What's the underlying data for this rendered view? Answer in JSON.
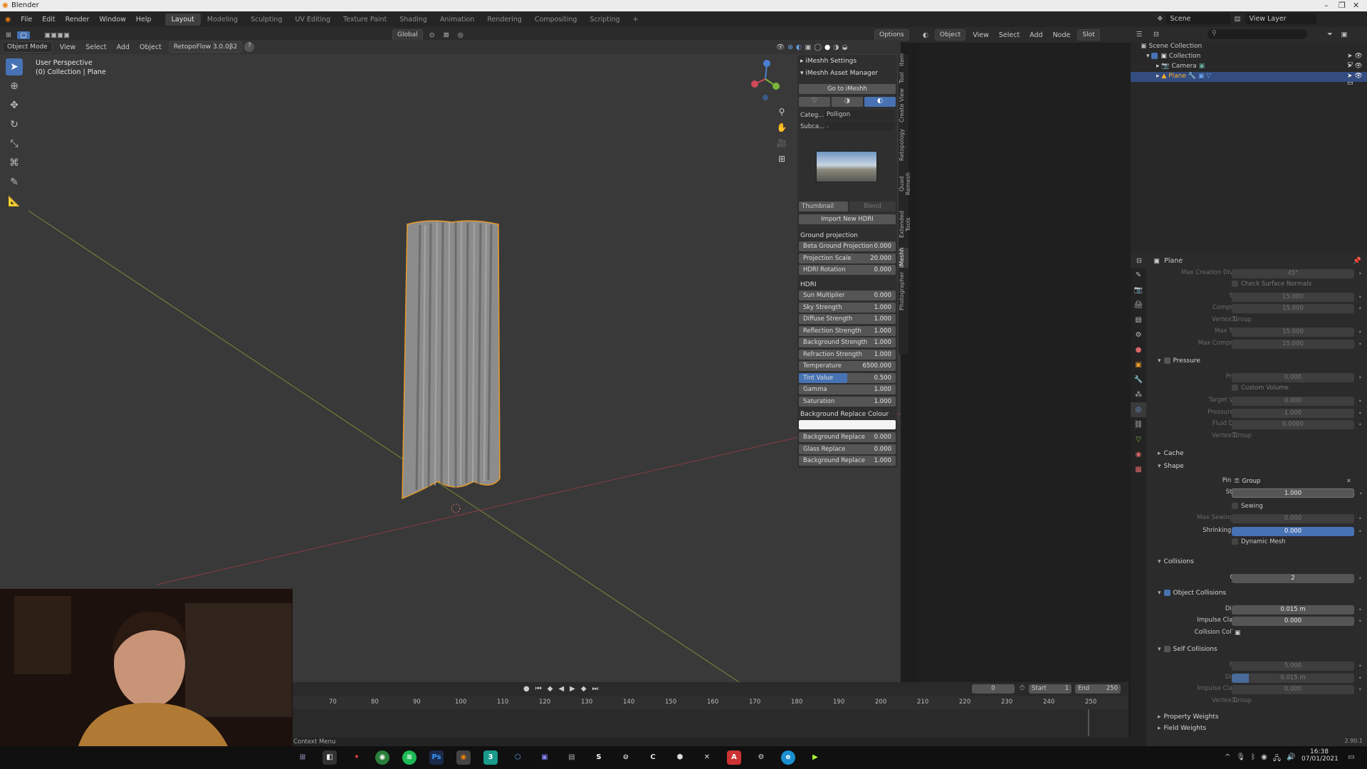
{
  "window": {
    "title": "Blender"
  },
  "menus": [
    "File",
    "Edit",
    "Render",
    "Window",
    "Help"
  ],
  "workspaces": [
    {
      "label": "Layout",
      "active": true
    },
    {
      "label": "Modeling"
    },
    {
      "label": "Sculpting"
    },
    {
      "label": "UV Editing"
    },
    {
      "label": "Texture Paint"
    },
    {
      "label": "Shading"
    },
    {
      "label": "Animation"
    },
    {
      "label": "Rendering"
    },
    {
      "label": "Compositing"
    },
    {
      "label": "Scripting"
    }
  ],
  "scene": {
    "label": "Scene",
    "view_layer": "View Layer"
  },
  "viewport_header": {
    "mode": "Object Mode",
    "view": "View",
    "select": "Select",
    "add": "Add",
    "object": "Object",
    "addon": "RetopoFlow 3.0.0β2",
    "orientation": "Global",
    "options": "Options"
  },
  "viewport": {
    "perspective": "User Perspective",
    "collection": "(0) Collection | Plane"
  },
  "node_header": {
    "object": "Object",
    "view": "View",
    "select": "Select",
    "add": "Add",
    "node": "Node",
    "slot": "Slot"
  },
  "imeshh": {
    "settings": "iMeshh Settings",
    "asset_manager": "iMeshh Asset Manager",
    "goto": "Go to iMeshh",
    "category_label": "Categ...",
    "category_value": "Polligon",
    "subcategory_label": "Subca...",
    "subcategory_value": ".",
    "thumbnail": "Thumbnail",
    "blend": "Blend",
    "import_hdri": "Import New HDRI",
    "ground_projection": "Ground projection",
    "ground_rows": [
      {
        "label": "Beta Ground Projection",
        "value": "0.000"
      },
      {
        "label": "Projection Scale",
        "value": "20.000"
      },
      {
        "label": "HDRI Rotation",
        "value": "0.000"
      }
    ],
    "hdri_header": "HDRI",
    "hdri_rows": [
      {
        "label": "Sun Multiplier",
        "value": "0.000"
      },
      {
        "label": "Sky Strength",
        "value": "1.000"
      },
      {
        "label": "Diffuse Strength",
        "value": "1.000"
      },
      {
        "label": "Reflection Strength",
        "value": "1.000"
      },
      {
        "label": "Background Strength",
        "value": "1.000"
      },
      {
        "label": "Refraction Strength",
        "value": "1.000"
      },
      {
        "label": "Temperature",
        "value": "6500.000"
      },
      {
        "label": "Tint Value",
        "value": "0.500",
        "fill": 0.5
      },
      {
        "label": "Gamma",
        "value": "1.000"
      },
      {
        "label": "Saturation",
        "value": "1.000"
      }
    ],
    "bg_replace_colour": "Background Replace Colour",
    "replace_rows": [
      {
        "label": "Background Replace",
        "value": "0.000"
      },
      {
        "label": "Glass Replace",
        "value": "0.000"
      },
      {
        "label": "Background Replace",
        "value": "1.000"
      }
    ]
  },
  "side_tabs": [
    "Item",
    "Tool",
    "View",
    "Create",
    "Retopology",
    "Quad Remesh",
    "Extended Tools",
    "iMeshh",
    "Photographer"
  ],
  "outliner": {
    "scene_collection": "Scene Collection",
    "items": [
      {
        "label": "Collection",
        "depth": 1
      },
      {
        "label": "Camera",
        "depth": 2
      },
      {
        "label": "Plane",
        "depth": 2,
        "selected": true
      }
    ]
  },
  "properties": {
    "object_name": "Plane",
    "max_creation_diversion_label": "Max Creation Diversion",
    "max_creation_diversion": "45°",
    "check_surface_normals": "Check Surface Normals",
    "tension_label": "Tension",
    "tension": "15.000",
    "compression_label": "Compression",
    "compression": "15.000",
    "vertex_group_label": "Vertex Group",
    "max_tension_label": "Max Tension",
    "max_tension": "15.000",
    "max_compression_label": "Max Compression",
    "max_compression": "15.000",
    "pressure": "Pressure",
    "pressure_label": "Pressure",
    "pressure_val": "0.000",
    "custom_volume": "Custom Volume",
    "target_volume_label": "Target Volume",
    "target_volume": "0.000",
    "pressure_scale_label": "Pressure Scale",
    "pressure_scale": "1.000",
    "fluid_density_label": "Fluid Density",
    "fluid_density": "0.0000",
    "cache": "Cache",
    "shape": "Shape",
    "pin_group_label": "Pin Group",
    "pin_group": "Group",
    "stiffness_label": "Stiffness",
    "stiffness": "1.000",
    "sewing": "Sewing",
    "max_sewing_force_label": "Max Sewing Force",
    "max_sewing_force": "0.000",
    "shrinking_factor_label": "Shrinking Factor",
    "shrinking_factor": "0.000",
    "dynamic_mesh": "Dynamic Mesh",
    "collisions": "Collisions",
    "quality_label": "Quality",
    "quality": "2",
    "object_collisions": "Object Collisions",
    "distance_label": "Distance",
    "distance": "0.015 m",
    "impulse_clamping_label": "Impulse Clamping",
    "impulse_clamping": "0.000",
    "collision_collection_label": "Collision Collection",
    "self_collisions": "Self Collisions",
    "friction_label": "Friction",
    "friction": "5.000",
    "self_distance_label": "Distance",
    "self_distance": "0.015 m",
    "self_impulse_label": "Impulse Clamping",
    "self_impulse": "0.000",
    "self_vertex_group_label": "Vertex Group",
    "property_weights": "Property Weights",
    "field_weights": "Field Weights",
    "version": "2.90.1"
  },
  "timeline": {
    "current_frame": "0",
    "start_label": "Start",
    "start": "1",
    "end_label": "End",
    "end": "250",
    "ticks": [
      "70",
      "80",
      "90",
      "100",
      "110",
      "120",
      "130",
      "140",
      "150",
      "160",
      "170",
      "180",
      "190",
      "200",
      "210",
      "220",
      "230",
      "240",
      "250"
    ]
  },
  "status": {
    "context_menu": "Context Menu"
  },
  "clock": {
    "time": "16:38",
    "date": "07/01/2021"
  }
}
